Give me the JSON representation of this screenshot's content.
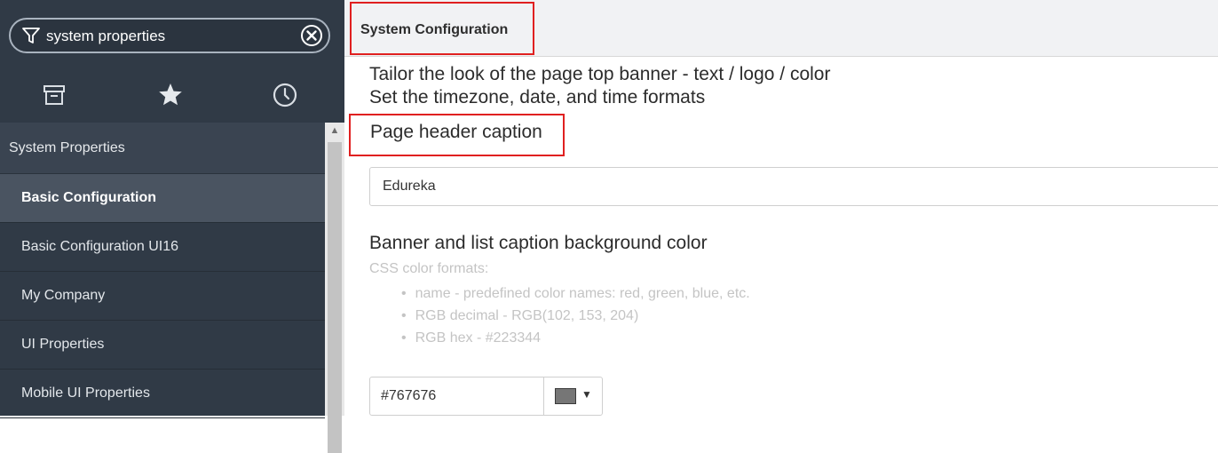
{
  "sidebar": {
    "filter": {
      "value": "system properties",
      "icon": "filter-icon",
      "clear_icon": "clear-circle-x-icon"
    },
    "nav_icons": [
      "archive-icon",
      "star-icon",
      "clock-icon"
    ],
    "section": "System Properties",
    "items": [
      {
        "label": "Basic Configuration",
        "active": true
      },
      {
        "label": "Basic Configuration UI16"
      },
      {
        "label": "My Company"
      },
      {
        "label": "UI Properties"
      },
      {
        "label": "Mobile UI Properties"
      }
    ]
  },
  "main": {
    "title": "System Configuration",
    "description": [
      "Tailor the look of the page top banner - text / logo / color",
      "Set the timezone, date, and time formats"
    ],
    "page_header_caption": {
      "label": "Page header caption",
      "value": "Edureka"
    },
    "banner_color": {
      "label": "Banner and list caption background color",
      "help_title": "CSS color formats:",
      "help_items": [
        "name - predefined color names: red, green, blue, etc.",
        "RGB decimal - RGB(102, 153, 204)",
        "RGB hex - #223344"
      ],
      "value": "#767676",
      "swatch_color": "#767676"
    }
  },
  "colors": {
    "sidebar_bg": "#303a46",
    "highlight_border": "#e02020"
  }
}
